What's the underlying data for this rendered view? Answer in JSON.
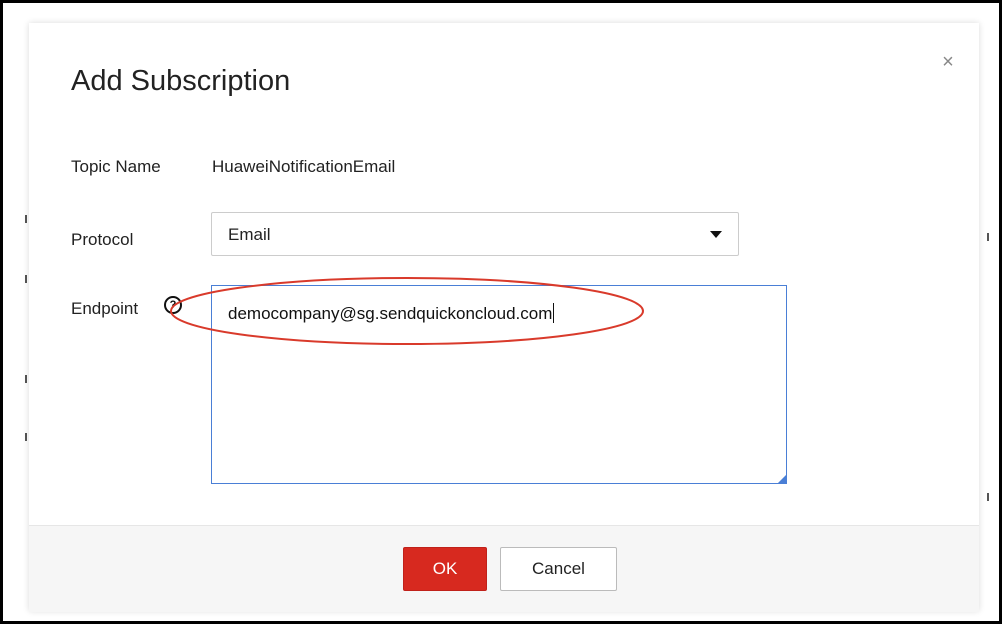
{
  "dialog": {
    "title": "Add Subscription",
    "close_glyph": "×"
  },
  "form": {
    "topic_name": {
      "label": "Topic Name",
      "value": "HuaweiNotificationEmail"
    },
    "protocol": {
      "label": "Protocol",
      "selected": "Email"
    },
    "endpoint": {
      "label": "Endpoint",
      "help_glyph": "?",
      "value": "democompany@sg.sendquickoncloud.com"
    }
  },
  "footer": {
    "ok_label": "OK",
    "cancel_label": "Cancel"
  },
  "icons": {
    "close": "close-icon",
    "help": "help-icon",
    "caret": "caret-down-icon"
  },
  "colors": {
    "primary_button": "#d7291f",
    "input_focus": "#4a7fd6",
    "annotation": "#d93a2b"
  }
}
